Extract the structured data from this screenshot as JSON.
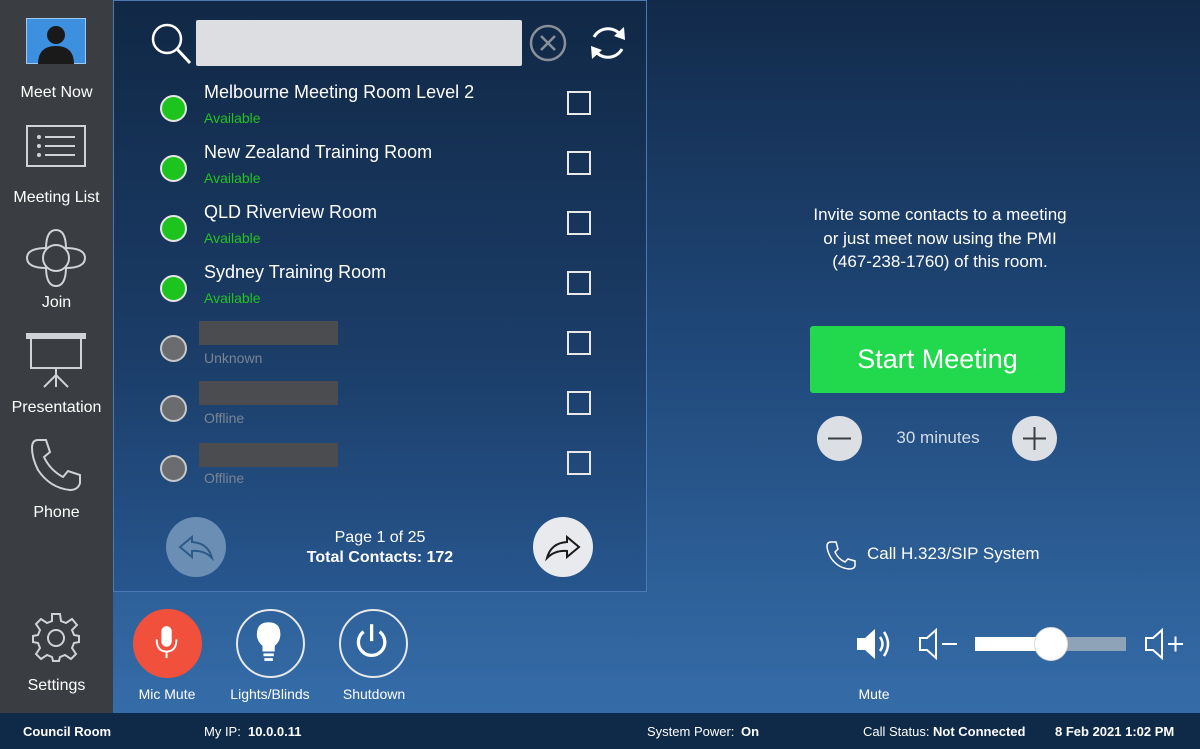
{
  "sidebar": {
    "items": [
      {
        "label": "Meet Now",
        "icon": "person-icon"
      },
      {
        "label": "Meeting List",
        "icon": "list-icon"
      },
      {
        "label": "Join",
        "icon": "join-icon"
      },
      {
        "label": "Presentation",
        "icon": "projector-screen-icon"
      },
      {
        "label": "Phone",
        "icon": "phone-icon"
      }
    ],
    "settings": {
      "label": "Settings",
      "icon": "gear-icon"
    }
  },
  "contacts": {
    "search": {
      "value": "",
      "placeholder": ""
    },
    "items": [
      {
        "name": "Melbourne Meeting Room Level 2",
        "status": "Available",
        "state": "green",
        "checked": false
      },
      {
        "name": "New Zealand Training Room",
        "status": "Available",
        "state": "green",
        "checked": false
      },
      {
        "name": "QLD Riverview Room",
        "status": "Available",
        "state": "green",
        "checked": false
      },
      {
        "name": "Sydney Training Room",
        "status": "Available",
        "state": "green",
        "checked": false
      },
      {
        "name": "",
        "status": "Unknown",
        "state": "grey",
        "checked": false
      },
      {
        "name": "",
        "status": "Offline",
        "state": "grey",
        "checked": false
      },
      {
        "name": "",
        "status": "Offline",
        "state": "grey",
        "checked": false
      }
    ],
    "pagination": {
      "page_text": "Page 1 of 25",
      "total_text": "Total Contacts: 172"
    }
  },
  "meeting": {
    "invite_line1": "Invite some contacts to a meeting",
    "invite_line2": "or just meet now using the PMI",
    "invite_line3": "(467-238-1760) of this room.",
    "start_label": "Start Meeting",
    "duration": "30 minutes",
    "call_sip_label": "Call H.323/SIP System"
  },
  "controls": {
    "mic_mute": "Mic Mute",
    "lights": "Lights/Blinds",
    "shutdown": "Shutdown",
    "mute": "Mute",
    "volume_level": 0.5
  },
  "status_bar": {
    "room": "Council Room",
    "ip_label": "My IP:",
    "ip_value": "10.0.0.11",
    "power_label": "System Power:",
    "power_value": "On",
    "call_label": "Call Status:",
    "call_value": "Not Connected",
    "datetime": "8 Feb 2021 1:02 PM"
  },
  "colors": {
    "available": "#22c222",
    "start_button": "#22d84c",
    "mic_mute": "#f0503c",
    "sidebar": "#3a3d41",
    "status_bar": "#0f2a49"
  }
}
